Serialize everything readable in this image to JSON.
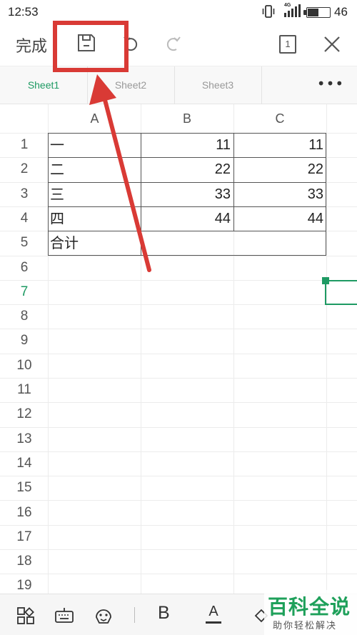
{
  "status_bar": {
    "time": "12:53",
    "network": "4G",
    "battery_text": "46",
    "battery_level": 0.46
  },
  "toolbar": {
    "done_label": "完成",
    "sheet_count": "1",
    "icons": [
      "save-icon",
      "undo-icon",
      "redo-icon",
      "sheets-icon",
      "close-icon"
    ]
  },
  "tabs": [
    {
      "label": "Sheet1",
      "active": true
    },
    {
      "label": "Sheet2",
      "active": false
    },
    {
      "label": "Sheet3",
      "active": false
    }
  ],
  "tabs_more_label": "•••",
  "grid": {
    "columns": [
      "A",
      "B",
      "C"
    ],
    "rows": [
      "1",
      "2",
      "3",
      "4",
      "5",
      "6",
      "7",
      "8",
      "9",
      "10",
      "11",
      "12",
      "13",
      "14",
      "15",
      "16",
      "17",
      "18",
      "19"
    ],
    "selected_row": "7",
    "cells": [
      {
        "a": "一",
        "b": "11",
        "c": "11"
      },
      {
        "a": "二",
        "b": "22",
        "c": "22"
      },
      {
        "a": "三",
        "b": "33",
        "c": "33"
      },
      {
        "a": "四",
        "b": "44",
        "c": "44"
      },
      {
        "a": "合计",
        "b": "",
        "c": ""
      }
    ]
  },
  "bottom_bar": {
    "bold_label": "B",
    "font_color_label": "A",
    "icons": [
      "apps-icon",
      "keyboard-icon",
      "emoji-icon",
      "bold-icon",
      "font-color-icon",
      "fill-color-icon"
    ]
  },
  "watermark": {
    "title": "百科全说",
    "subtitle": "助你轻松解决"
  },
  "colors": {
    "accent": "#1e9a63",
    "annotation": "#d93a35"
  }
}
